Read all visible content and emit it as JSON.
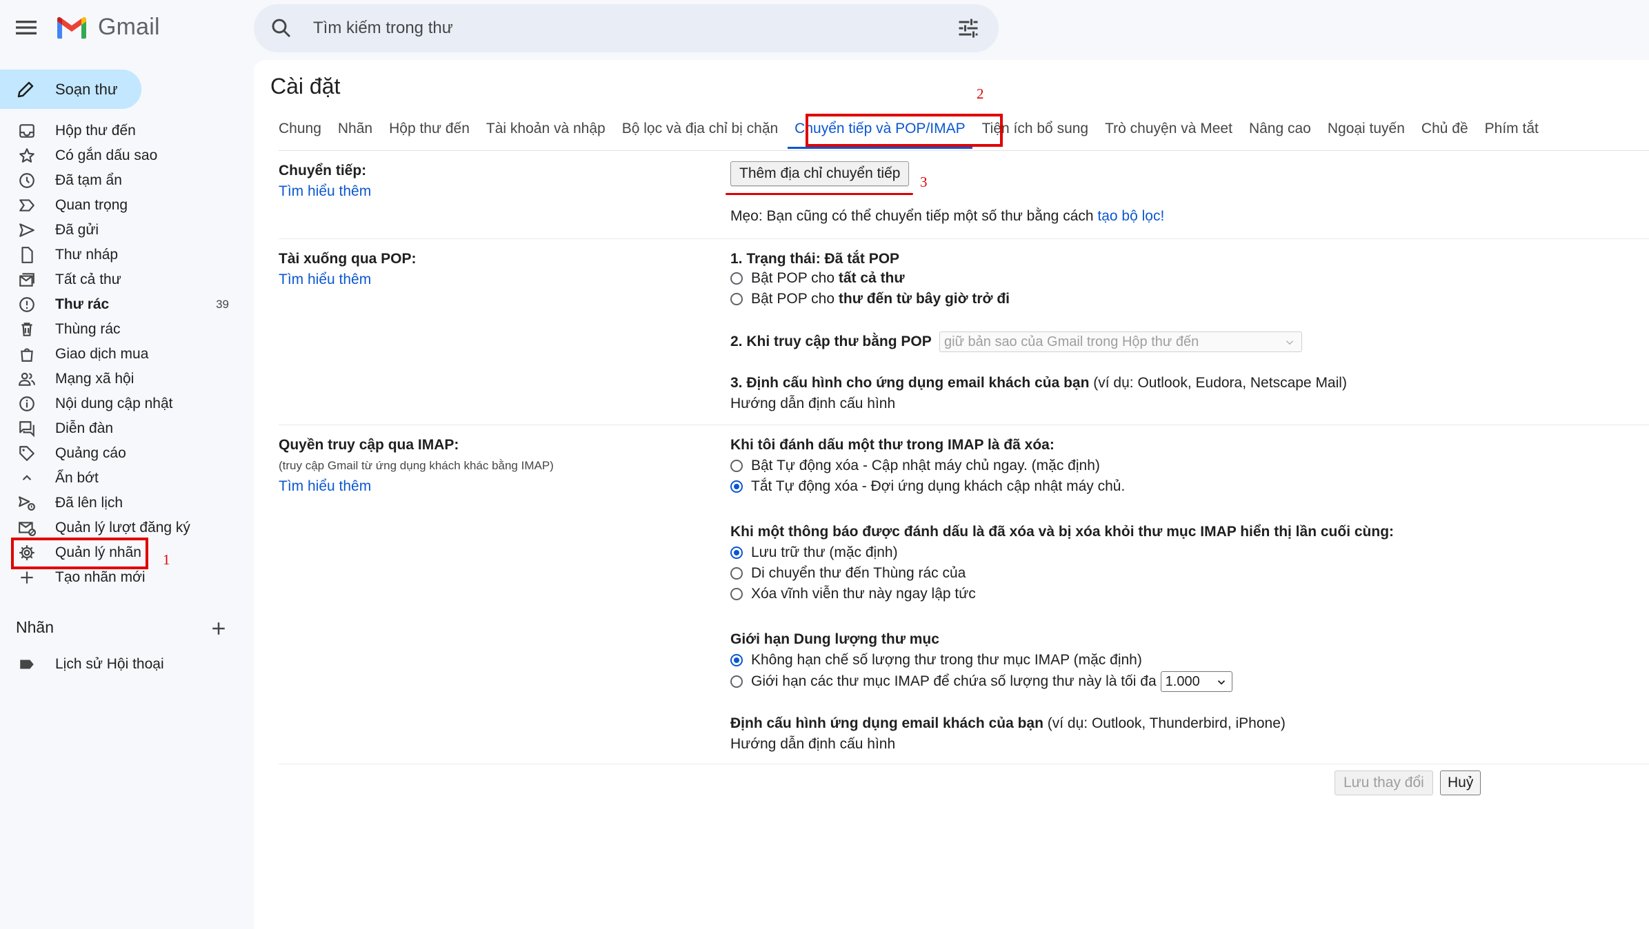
{
  "header": {
    "app_name": "Gmail",
    "search_placeholder": "Tìm kiếm trong thư"
  },
  "sidebar": {
    "compose_label": "Soạn thư",
    "items": [
      {
        "label": "Hộp thư đến",
        "icon": "inbox-icon"
      },
      {
        "label": "Có gắn dấu sao",
        "icon": "star-icon"
      },
      {
        "label": "Đã tạm ẩn",
        "icon": "clock-icon"
      },
      {
        "label": "Quan trọng",
        "icon": "important-icon"
      },
      {
        "label": "Đã gửi",
        "icon": "send-icon"
      },
      {
        "label": "Thư nháp",
        "icon": "draft-icon"
      },
      {
        "label": "Tất cả thư",
        "icon": "all-mail-icon"
      },
      {
        "label": "Thư rác",
        "icon": "spam-icon",
        "count": "39"
      },
      {
        "label": "Thùng rác",
        "icon": "trash-icon"
      },
      {
        "label": "Giao dịch mua",
        "icon": "purchases-icon"
      },
      {
        "label": "Mạng xã hội",
        "icon": "social-icon"
      },
      {
        "label": "Nội dung cập nhật",
        "icon": "updates-icon"
      },
      {
        "label": "Diễn đàn",
        "icon": "forums-icon"
      },
      {
        "label": "Quảng cáo",
        "icon": "promotions-icon"
      },
      {
        "label": "Ẩn bớt",
        "icon": "chevron-up-icon"
      },
      {
        "label": "Đã lên lịch",
        "icon": "scheduled-icon"
      },
      {
        "label": "Quản lý lượt đăng ký",
        "icon": "subscriptions-icon"
      },
      {
        "label": "Quản lý nhãn",
        "icon": "gear-icon"
      },
      {
        "label": "Tạo nhãn mới",
        "icon": "plus-icon"
      }
    ],
    "labels_heading": "Nhãn",
    "labels": [
      {
        "label": "Lịch sử Hội thoại",
        "icon": "label-icon"
      }
    ]
  },
  "settings": {
    "title": "Cài đặt",
    "tabs": [
      "Chung",
      "Nhãn",
      "Hộp thư đến",
      "Tài khoản và nhập",
      "Bộ lọc và địa chỉ bị chặn",
      "Chuyển tiếp và POP/IMAP",
      "Tiện ích bổ sung",
      "Trò chuyện và Meet",
      "Nâng cao",
      "Ngoại tuyến",
      "Chủ đề",
      "Phím tắt"
    ],
    "active_tab": "Chuyển tiếp và POP/IMAP",
    "forwarding": {
      "heading": "Chuyển tiếp:",
      "learn_more": "Tìm hiểu thêm",
      "add_button": "Thêm địa chỉ chuyển tiếp",
      "tip_prefix": "Mẹo: Bạn cũng có thể chuyển tiếp một số thư bằng cách ",
      "tip_link": "tạo bộ lọc!"
    },
    "pop": {
      "heading": "Tài xuống qua POP:",
      "learn_more": "Tìm hiểu thêm",
      "status": "1. Trạng thái: Đã tắt POP",
      "opt1_prefix": "Bật POP cho ",
      "opt1_bold": "tất cả thư",
      "opt2_prefix": "Bật POP cho ",
      "opt2_bold": "thư đến từ bây giờ trở đi",
      "access_label": "2. Khi truy cập thư bằng POP",
      "access_select": "giữ bản sao của Gmail trong Hộp thư đến",
      "config_bold": "3. Định cấu hình cho ứng dụng email khách của bạn",
      "config_rest": " (ví dụ: Outlook, Eudora, Netscape Mail)",
      "config_link": "Hướng dẫn định cấu hình"
    },
    "imap": {
      "heading": "Quyền truy cập qua IMAP:",
      "subtext": "(truy cập Gmail từ ứng dụng khách khác bằng IMAP)",
      "learn_more": "Tìm hiểu thêm",
      "q1": "Khi tôi đánh dấu một thư trong IMAP là đã xóa:",
      "q1_opt1": "Bật Tự động xóa - Cập nhật máy chủ ngay. (mặc định)",
      "q1_opt2": "Tắt Tự động xóa - Đợi ứng dụng khách cập nhật máy chủ.",
      "q2": "Khi một thông báo được đánh dấu là đã xóa và bị xóa khỏi thư mục IMAP hiển thị lần cuối cùng:",
      "q2_opt1": "Lưu trữ thư (mặc định)",
      "q2_opt2": "Di chuyển thư đến Thùng rác của",
      "q2_opt3": "Xóa vĩnh viễn thư này ngay lập tức",
      "q3": "Giới hạn Dung lượng thư mục",
      "q3_opt1": "Không hạn chế số lượng thư trong thư mục IMAP (mặc định)",
      "q3_opt2": "Giới hạn các thư mục IMAP để chứa số lượng thư này là tối đa",
      "q3_select": "1.000",
      "config_bold": "Định cấu hình ứng dụng email khách của bạn",
      "config_rest": " (ví dụ: Outlook, Thunderbird, iPhone)",
      "config_link": "Hướng dẫn định cấu hình"
    },
    "save_button": "Lưu thay đổi",
    "cancel_button": "Huỷ"
  },
  "annotations": [
    "1",
    "2",
    "3"
  ],
  "colors": {
    "annotation": "#e00000",
    "accent": "#0b57d0",
    "compose_bg": "#c2e7ff"
  }
}
